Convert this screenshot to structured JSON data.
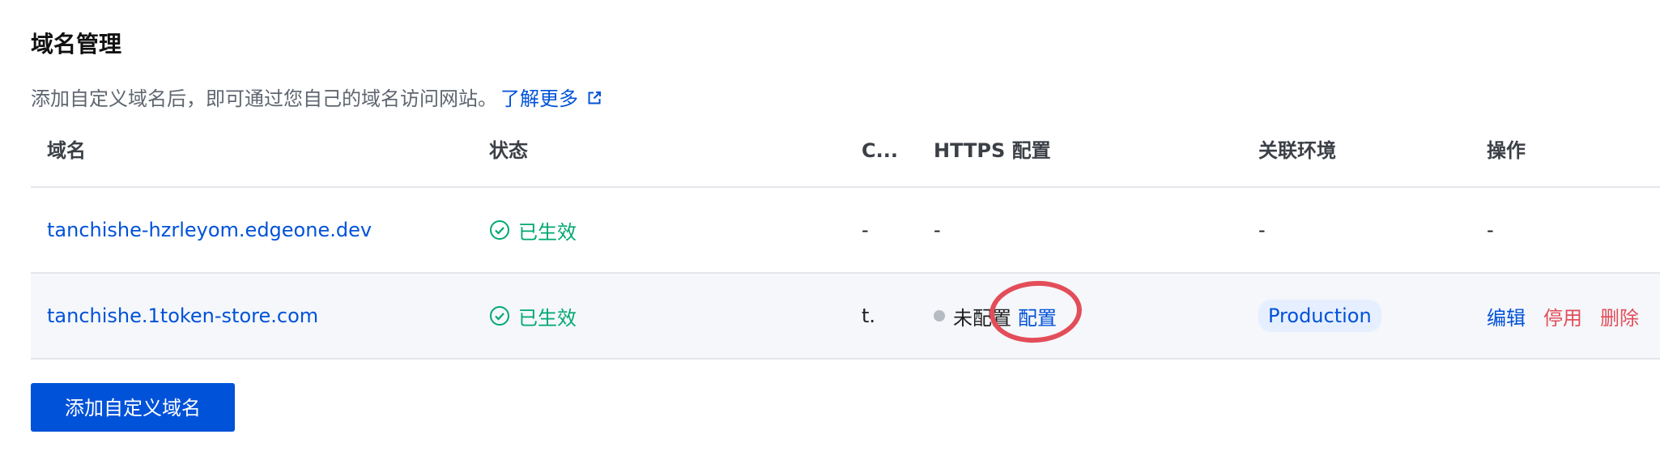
{
  "page": {
    "title": "域名管理",
    "description": "添加自定义域名后，即可通过您自己的域名访问网站。",
    "learn_more": "了解更多"
  },
  "table": {
    "headers": {
      "domain": "域名",
      "status": "状态",
      "c": "C...",
      "https": "HTTPS 配置",
      "env": "关联环境",
      "ops": "操作"
    },
    "rows": [
      {
        "domain": "tanchishe-hzrleyom.edgeone.dev",
        "status": "已生效",
        "c": "-",
        "https": "-",
        "env": "-",
        "ops": "-"
      },
      {
        "domain": "tanchishe.1token-store.com",
        "status": "已生效",
        "c": "t.",
        "https_status": "未配置",
        "https_action": "配置",
        "env": "Production",
        "actions": {
          "edit": "编辑",
          "disable": "停用",
          "delete": "删除"
        }
      }
    ]
  },
  "add_button": "添加自定义域名",
  "colors": {
    "primary": "#0052d9",
    "success": "#00a870",
    "danger": "#e34d59",
    "annotation": "#e34d59"
  }
}
